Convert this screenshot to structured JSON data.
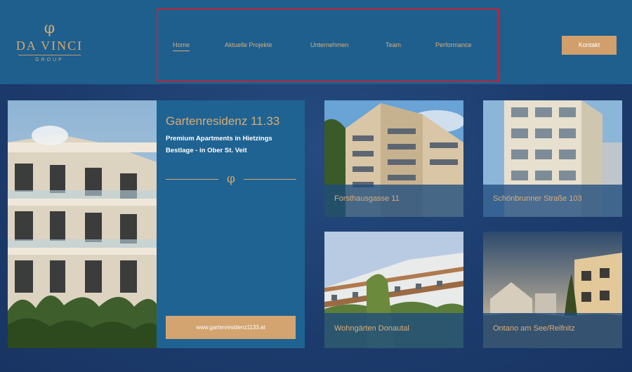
{
  "logo": {
    "symbol": "φ",
    "name": "DA VINCI",
    "sub": "GROUP"
  },
  "nav": {
    "items": [
      {
        "label": "Home",
        "active": true
      },
      {
        "label": "Aktuelle Projekte",
        "active": false
      },
      {
        "label": "Unternehmen",
        "active": false
      },
      {
        "label": "Team",
        "active": false
      },
      {
        "label": "Performance",
        "active": false
      }
    ]
  },
  "header": {
    "contact_label": "Kontakt"
  },
  "feature": {
    "title": "Gartenresidenz 11.33",
    "subtitle": "Premium Apartments in Hietzings Bestlage - in Ober St. Veit",
    "divider_symbol": "φ",
    "link_label": "www.gartenresidenz1133.at"
  },
  "projects": [
    {
      "title": "Forsthausgasse 11"
    },
    {
      "title": "Schönbrunner Straße 103"
    },
    {
      "title": "Wohngärten Donautal"
    },
    {
      "title": "Ontano am See/Reifnitz"
    }
  ],
  "colors": {
    "accent": "#d3a470",
    "header_bg": "#1e5f8e",
    "page_bg": "#1f3f70",
    "nav_highlight_border": "#c0233a"
  }
}
